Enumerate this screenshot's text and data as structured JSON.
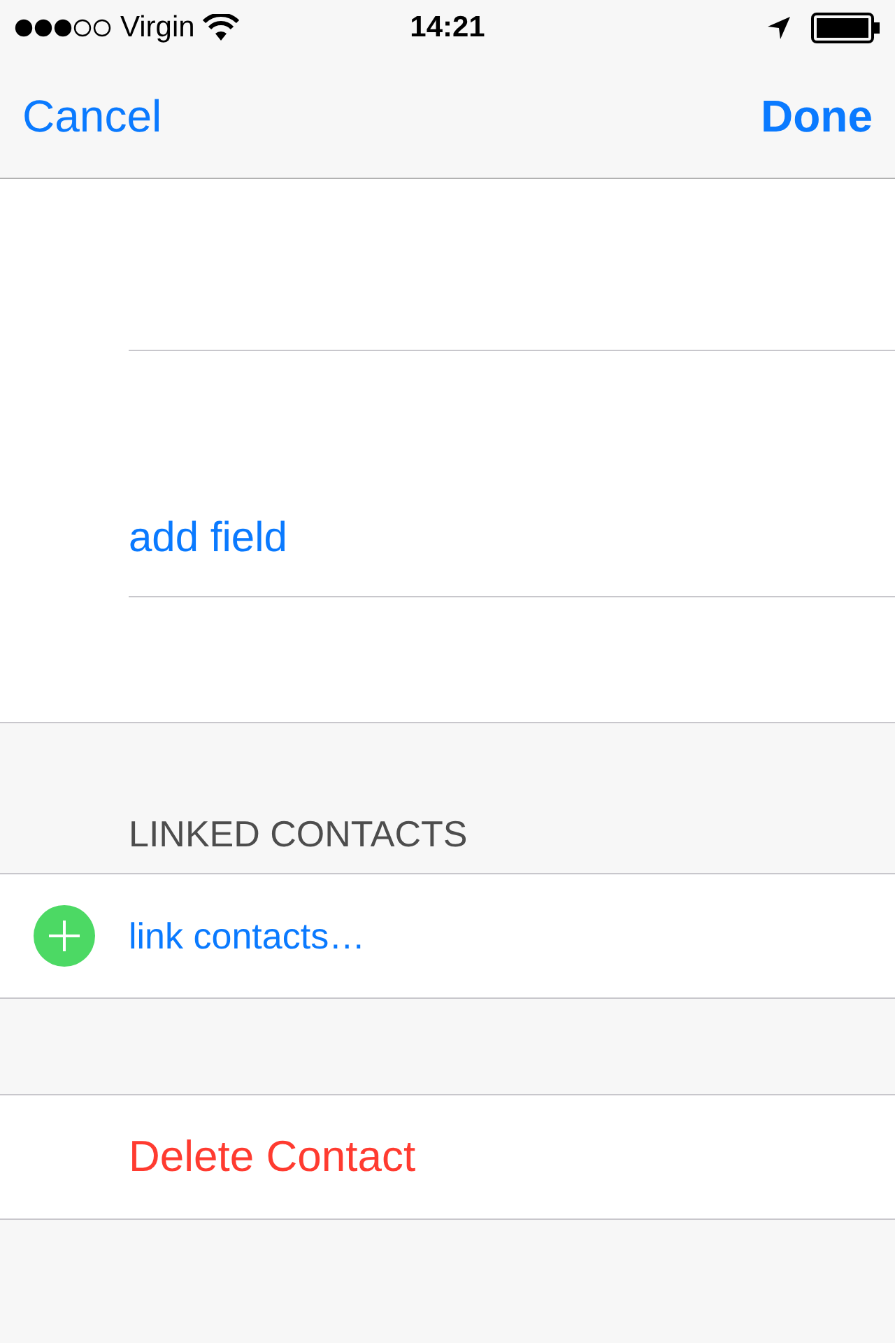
{
  "status_bar": {
    "carrier": "Virgin",
    "time": "14:21"
  },
  "nav_bar": {
    "left_button": "Cancel",
    "right_button": "Done"
  },
  "fields": {
    "add_field": "add field"
  },
  "linked_contacts": {
    "header": "LINKED CONTACTS",
    "link_button": "link contacts…"
  },
  "delete_button": "Delete Contact"
}
